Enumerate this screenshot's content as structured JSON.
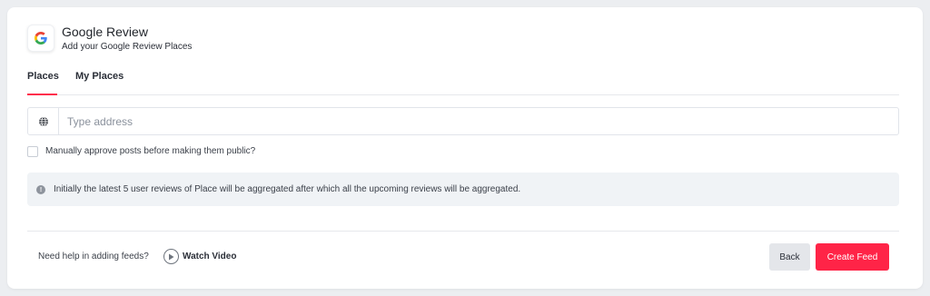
{
  "header": {
    "title": "Google Review",
    "subtitle": "Add your Google Review Places",
    "logo_icon": "google-g-icon"
  },
  "tabs": [
    {
      "label": "Places",
      "active": true
    },
    {
      "label": "My Places",
      "active": false
    }
  ],
  "address": {
    "placeholder": "Type address",
    "value": "",
    "icon": "globe-icon"
  },
  "approve": {
    "label": "Manually approve posts before making them public?",
    "checked": false
  },
  "info": {
    "icon": "info-icon",
    "text": "Initially the latest 5 user reviews of Place will be aggregated after which all the upcoming reviews will be aggregated."
  },
  "footer": {
    "help_text": "Need help in adding feeds?",
    "watch_video_label": "Watch Video",
    "back_label": "Back",
    "create_label": "Create Feed"
  },
  "colors": {
    "accent": "#ff2447",
    "background": "#eceef1",
    "info_bg": "#f0f3f6"
  }
}
